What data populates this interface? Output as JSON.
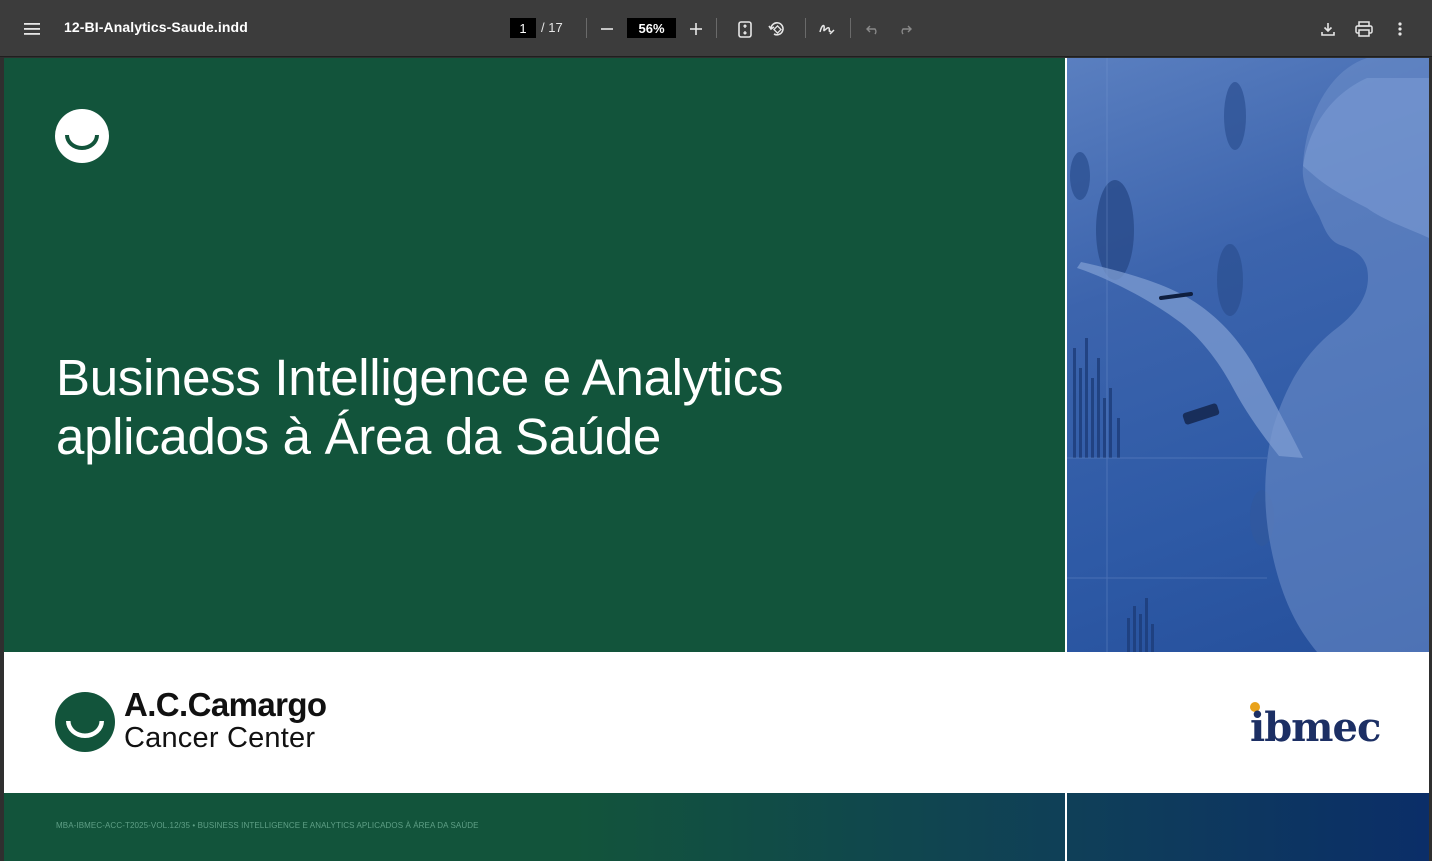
{
  "toolbar": {
    "document_title": "12-BI-Analytics-Saude.indd",
    "current_page": "1",
    "total_pages": "/ 17",
    "zoom": "56%",
    "icons": [
      "menu-icon",
      "zoom-out-icon",
      "zoom-in-icon",
      "fit-page-icon",
      "rotate-icon",
      "annotate-icon",
      "undo-icon",
      "redo-icon",
      "download-icon",
      "print-icon",
      "more-icon"
    ]
  },
  "document": {
    "title_line1": "Business Intelligence e Analytics",
    "title_line2": "aplicados à Área da Saúde",
    "institution_name": "A.C.Camargo",
    "institution_subtitle": "Cancer Center",
    "partner_logo": "ibmec",
    "footer": "MBA-IBMEC-ACC-T2025-VOL.12/35 • BUSINESS INTELLIGENCE E ANALYTICS APLICADOS À ÁREA DA SAÚDE"
  },
  "colors": {
    "toolbar_bg": "#3c3c3c",
    "brand_green": "#12543b",
    "photo_blue": "#3c64ad",
    "ibmec_navy": "#1c2f64",
    "ibmec_accent": "#e9a21a"
  }
}
